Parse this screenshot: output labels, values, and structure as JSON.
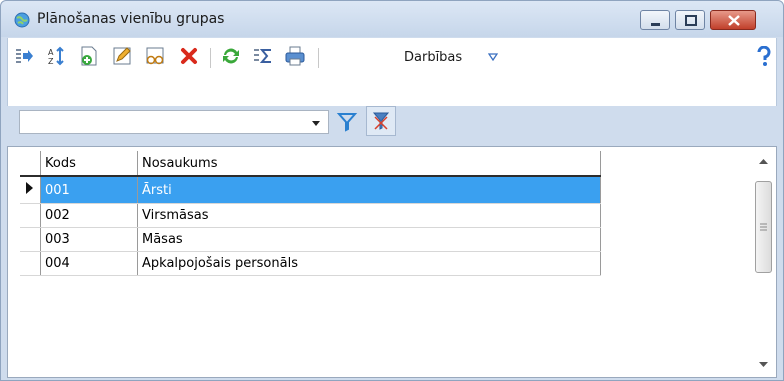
{
  "window": {
    "title": "Plānošanas vienību grupas",
    "icon": "globe-icon"
  },
  "toolbar": {
    "buttons": [
      {
        "name": "export-icon"
      },
      {
        "name": "sort-icon"
      },
      {
        "name": "add-icon"
      },
      {
        "name": "edit-icon"
      },
      {
        "name": "view-icon"
      },
      {
        "name": "delete-icon"
      },
      {
        "name": "refresh-icon"
      },
      {
        "name": "sum-icon"
      },
      {
        "name": "print-icon"
      }
    ],
    "actions_label": "Darbības",
    "help_icon": "help-icon"
  },
  "filter": {
    "combo_value": "",
    "filter_icon": "funnel-icon",
    "clear_icon": "clear-filter-icon"
  },
  "grid": {
    "columns": [
      "Kods",
      "Nosaukums"
    ],
    "rows": [
      {
        "kods": "001",
        "nosaukums": "Ārsti",
        "selected": true
      },
      {
        "kods": "002",
        "nosaukums": "Virsmāsas",
        "selected": false
      },
      {
        "kods": "003",
        "nosaukums": "Māsas",
        "selected": false
      },
      {
        "kods": "004",
        "nosaukums": "Apkalpojošais personāls",
        "selected": false
      }
    ]
  },
  "colors": {
    "selection": "#3aa0f0",
    "title_bg": "#cfdced"
  }
}
